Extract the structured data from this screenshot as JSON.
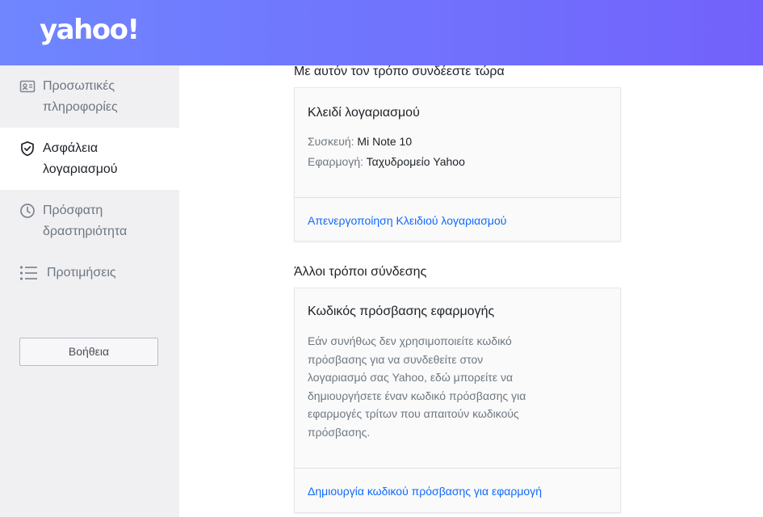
{
  "brand": {
    "logo_text": "yahoo!"
  },
  "sidebar": {
    "items": [
      {
        "icon": "id-card-icon",
        "label_line1": "Προσωπικές",
        "label_line2": "πληροφορίες",
        "active": false
      },
      {
        "icon": "shield-check-icon",
        "label_line1": "Ασφάλεια",
        "label_line2": "λογαριασμού",
        "active": true
      },
      {
        "icon": "clock-icon",
        "label_line1": "Πρόσφατη",
        "label_line2": "δραστηριότητα",
        "active": false
      },
      {
        "icon": "list-icon",
        "label_line1": "Προτιμήσεις",
        "label_line2": "",
        "active": false
      }
    ],
    "help_label": "Βοήθεια"
  },
  "main": {
    "current_section_title": "Με αυτόν τον τρόπο συνδέεστε τώρα",
    "account_key_card": {
      "title": "Κλειδί λογαριασμού",
      "device_label": "Συσκευή:",
      "device_value": "Mi Note 10",
      "app_label": "Εφαρμογή:",
      "app_value": "Ταχυδρομείο Yahoo",
      "action_link": "Απενεργοποίηση Κλειδιού λογαριασμού"
    },
    "other_section_title": "Άλλοι τρόποι σύνδεσης",
    "app_password_card": {
      "title": "Κωδικός πρόσβασης εφαρμογής",
      "desc_lines": [
        "Εάν συνήθως δεν χρησιμοποιείτε κωδικό",
        "πρόσβασης για να συνδεθείτε στον",
        "λογαριασμό σας Yahoo, εδώ μπορείτε να",
        "δημιουργήσετε έναν κωδικό πρόσβασης για",
        "εφαρμογές τρίτων που απαιτούν κωδικούς",
        "πρόσβασης."
      ],
      "action_link": "Δημιουργία κωδικού πρόσβασης για εφαρμογή"
    }
  },
  "colors": {
    "header_gradient_start": "#6f86ff",
    "header_gradient_end": "#7262fb",
    "link": "#0f69ff",
    "sidebar_bg": "#f0f0f3"
  }
}
